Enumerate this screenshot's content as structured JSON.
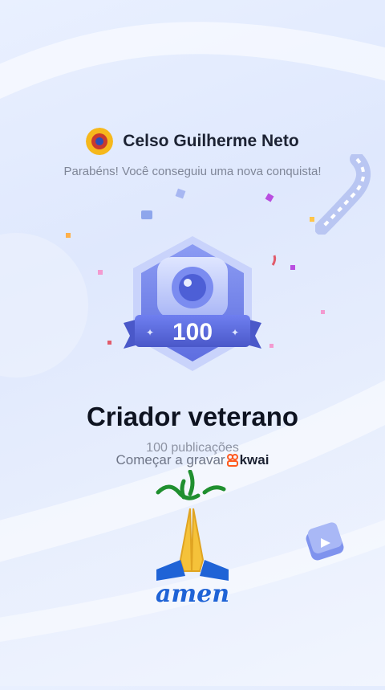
{
  "header": {
    "username": "Celso Guilherme Neto",
    "subtitle": "Parabéns! Você conseguiu uma nova conquista!"
  },
  "achievement": {
    "badge_number": "100",
    "title": "Criador veterano",
    "count_text": "100 publicações"
  },
  "cta": {
    "record_label": "Começar a gravar",
    "brand": "kwai"
  },
  "sticker": {
    "text": "amen"
  },
  "colors": {
    "accent": "#5f74e8",
    "kwai_orange": "#ff5a1f",
    "amen_blue": "#1f63d6"
  },
  "icons": [
    "praying-hands-icon",
    "camera-icon",
    "film-strip-icon",
    "play-icon",
    "kwai-logo-icon"
  ]
}
